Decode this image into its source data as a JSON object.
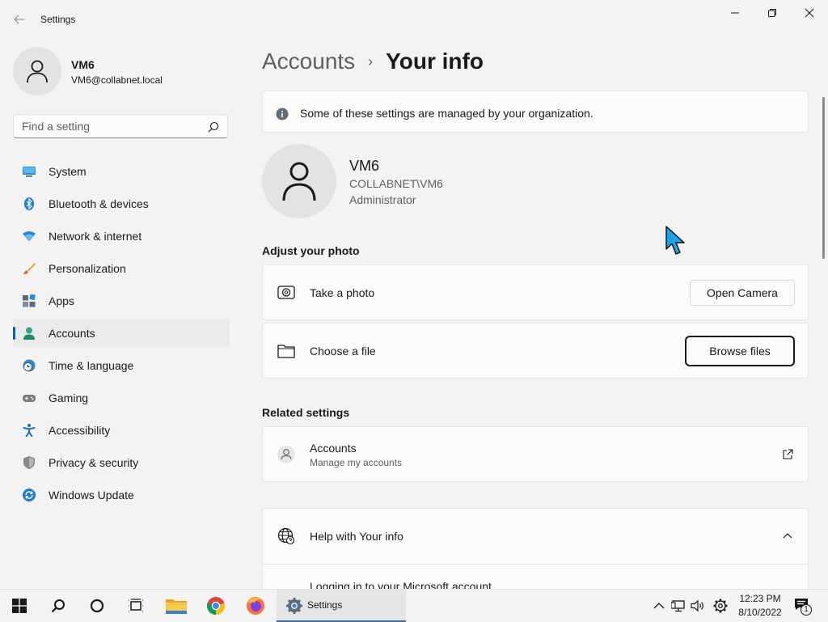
{
  "window": {
    "title": "Settings"
  },
  "profile": {
    "name": "VM6",
    "email": "VM6@collabnet.local"
  },
  "search": {
    "placeholder": "Find a setting"
  },
  "sidebar": {
    "items": [
      {
        "label": "System",
        "icon": "monitor-icon"
      },
      {
        "label": "Bluetooth & devices",
        "icon": "bluetooth-icon"
      },
      {
        "label": "Network & internet",
        "icon": "wifi-icon"
      },
      {
        "label": "Personalization",
        "icon": "brush-icon"
      },
      {
        "label": "Apps",
        "icon": "apps-icon"
      },
      {
        "label": "Accounts",
        "icon": "person-icon",
        "active": true
      },
      {
        "label": "Time & language",
        "icon": "globe-clock-icon"
      },
      {
        "label": "Gaming",
        "icon": "gamepad-icon"
      },
      {
        "label": "Accessibility",
        "icon": "accessibility-icon"
      },
      {
        "label": "Privacy & security",
        "icon": "shield-icon"
      },
      {
        "label": "Windows Update",
        "icon": "update-icon"
      }
    ]
  },
  "breadcrumb": {
    "parent": "Accounts",
    "separator": "›",
    "current": "Your info"
  },
  "notice": {
    "text": "Some of these settings are managed by your organization."
  },
  "user": {
    "name": "VM6",
    "domain": "COLLABNET\\VM6",
    "role": "Administrator"
  },
  "photo": {
    "heading": "Adjust your photo",
    "take_photo_label": "Take a photo",
    "open_camera_button": "Open Camera",
    "choose_file_label": "Choose a file",
    "browse_files_button": "Browse files"
  },
  "related": {
    "heading": "Related settings",
    "accounts_title": "Accounts",
    "accounts_subtitle": "Manage my accounts"
  },
  "help": {
    "title": "Help with Your info",
    "partial_link": "Logging in to your Microsoft account"
  },
  "taskbar": {
    "app_label": "Settings",
    "time": "12:23 PM",
    "date": "8/10/2022",
    "notification_count": "1"
  },
  "colors": {
    "accent": "#005fb8",
    "background": "#f3f3f3",
    "card": "#fbfbfb",
    "cursor": "#1aa3e6"
  }
}
